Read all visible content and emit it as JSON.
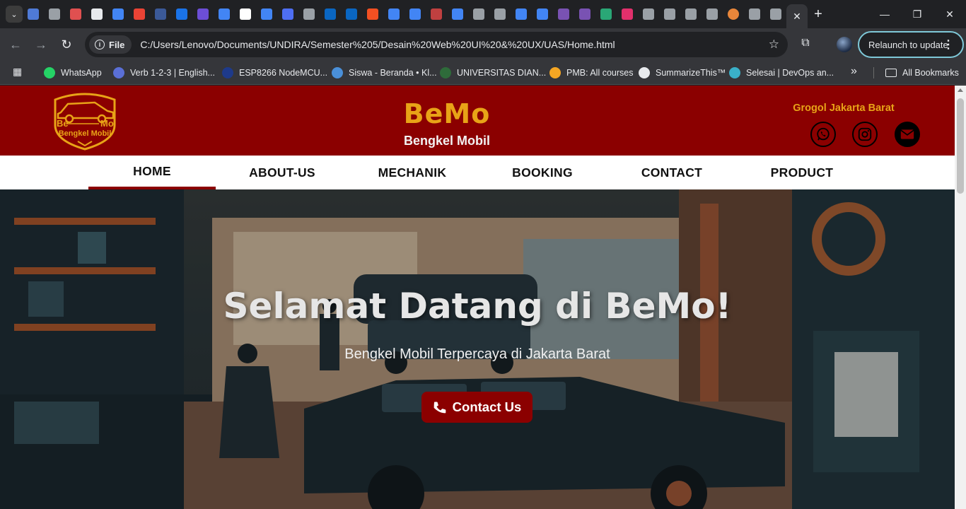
{
  "browser": {
    "active_tab_close": "✕",
    "new_tab": "+",
    "site_info_label": "File",
    "url": "C:/Users/Lenovo/Documents/UNDIRA/Semester%205/Desain%20Web%20UI%20&%20UX/UAS/Home.html",
    "relaunch_label": "Relaunch to update",
    "tab_favicons": [
      "#4f7ad6",
      "#9aa0a6",
      "#e05050",
      "#e8eaed",
      "#4285f4",
      "#ea4335",
      "#3b5998",
      "#1a73e8",
      "#6c4ed6",
      "#4285f4",
      "#ffffff",
      "#4285f4",
      "#4e6ef2",
      "#9aa0a6",
      "#0a66c2",
      "#0a66c2",
      "#f25022",
      "#4285f4",
      "#4285f4",
      "#c04040",
      "#4285f4",
      "#9aa0a6",
      "#9aa0a6",
      "#4285f4",
      "#4285f4",
      "#7952b3",
      "#7952b3",
      "#2aa776",
      "#e1306c",
      "#9aa0a6",
      "#9aa0a6",
      "#9aa0a6",
      "#9aa0a6",
      "#e8863a",
      "#9aa0a6",
      "#9aa0a6"
    ]
  },
  "bookmarks": [
    {
      "label": "WhatsApp",
      "color": "#25d366"
    },
    {
      "label": "Verb 1-2-3 | English...",
      "color": "#5a6fd6"
    },
    {
      "label": "ESP8266 NodeMCU...",
      "color": "#1e3a8a"
    },
    {
      "label": "Siswa - Beranda • Kl...",
      "color": "#4a90d9"
    },
    {
      "label": "UNIVERSITAS DIAN...",
      "color": "#2e6b3a"
    },
    {
      "label": "PMB: All courses",
      "color": "#f5a623"
    },
    {
      "label": "SummarizeThis™",
      "color": "#e8eaed"
    },
    {
      "label": "Selesai | DevOps an...",
      "color": "#3ab0c8"
    }
  ],
  "bookmarks_all": "All Bookmarks",
  "site": {
    "logo_text_top": "Be",
    "logo_text_top_right": "Mo",
    "logo_text_bottom": "Bengkel Mobil",
    "title": "BeMo",
    "subtitle": "Bengkel Mobil",
    "location": "Grogol Jakarta Barat",
    "nav": [
      "HOME",
      "ABOUT-US",
      "MECHANIK",
      "BOOKING",
      "CONTACT",
      "PRODUCT"
    ],
    "hero_title": "Selamat Datang di BeMo!",
    "hero_subtitle": "Bengkel Mobil Terpercaya di Jakarta Barat",
    "hero_button": "Contact Us",
    "colors": {
      "primary": "#8b0000",
      "accent": "#e8a317"
    }
  }
}
